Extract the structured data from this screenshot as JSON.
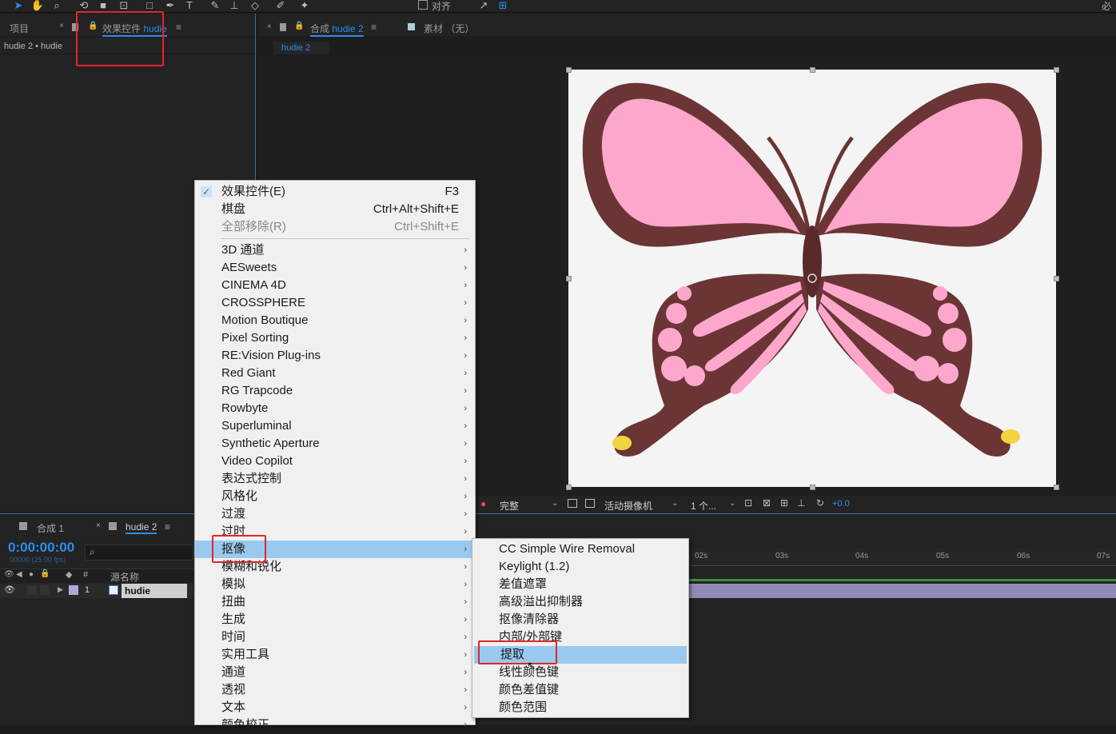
{
  "toolbar": {
    "align_label": "对齐",
    "right_label": "必要"
  },
  "project_panel": {
    "tab_project": "项目",
    "tab_effects_prefix": "效果控件",
    "tab_effects_name": "hudie",
    "breadcrumb": "hudie 2 • hudie"
  },
  "comp_panel": {
    "tab_comp_prefix": "合成",
    "tab_comp_name": "hudie 2",
    "tab_footage": "素材 （无）",
    "sub_tab": "hudie 2"
  },
  "viewer_bar": {
    "quality": "完整",
    "camera": "活动摄像机",
    "views": "1 个...",
    "exposure": "+0.0"
  },
  "timeline": {
    "tab1": "合成 1",
    "tab2": "hudie 2",
    "timecode": "0:00:00:00",
    "frames": "00000 (25.00 fps)",
    "col_num": "#",
    "col_source": "源名称",
    "layer_index": "1",
    "layer_name": "hudie",
    "ruler": [
      "02s",
      "03s",
      "04s",
      "05s",
      "06s",
      "07s"
    ]
  },
  "context_menu": {
    "top_items": [
      {
        "label": "效果控件(E)",
        "shortcut": "F3",
        "checked": true
      },
      {
        "label": "棋盘",
        "shortcut": "Ctrl+Alt+Shift+E"
      },
      {
        "label": "全部移除(R)",
        "shortcut": "Ctrl+Shift+E",
        "disabled": true
      }
    ],
    "categories": [
      "3D 通道",
      "AESweets",
      "CINEMA 4D",
      "CROSSPHERE",
      "Motion Boutique",
      "Pixel Sorting",
      "RE:Vision Plug-ins",
      "Red Giant",
      "RG Trapcode",
      "Rowbyte",
      "Superluminal",
      "Synthetic Aperture",
      "Video Copilot",
      "表达式控制",
      "风格化",
      "过渡",
      "过时",
      "抠像",
      "模糊和锐化",
      "模拟",
      "扭曲",
      "生成",
      "时间",
      "实用工具",
      "通道",
      "透视",
      "文本",
      "颜色校正"
    ]
  },
  "submenu": {
    "items": [
      "CC Simple Wire Removal",
      "Keylight (1.2)",
      "差值遮罩",
      "高级溢出抑制器",
      "抠像清除器",
      "内部/外部键",
      "提取",
      "线性颜色键",
      "颜色差值键",
      "颜色范围"
    ]
  },
  "colors": {
    "accent": "#2d8ceb",
    "highlight": "#99c9ef",
    "annotation": "#e0262a",
    "wing_pink": "#fda7cd",
    "body_brown": "#6b3535"
  }
}
